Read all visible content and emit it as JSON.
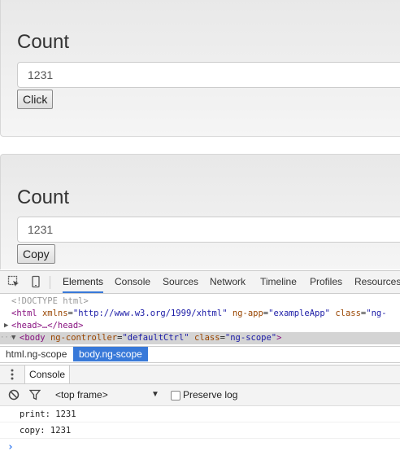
{
  "panels": [
    {
      "title": "Count",
      "input_value": "1231",
      "button_label": "Click"
    },
    {
      "title": "Count",
      "input_value": "1231",
      "button_label": "Copy"
    }
  ],
  "devtools": {
    "tabs": [
      "Elements",
      "Console",
      "Sources",
      "Network",
      "Timeline",
      "Profiles",
      "Resources"
    ],
    "active_tab": "Elements",
    "dom": {
      "doctype": "<!DOCTYPE html>",
      "html_open": "<html",
      "html_attr1_name": "xmlns",
      "html_attr1_value": "\"http://www.w3.org/1999/xhtml\"",
      "html_attr2_name": "ng-app",
      "html_attr2_value": "\"exampleApp\"",
      "html_attr3_name": "class",
      "html_attr3_value": "\"ng-",
      "head": "<head>…</head>",
      "body_open": "<body",
      "body_attr1_name": "ng-controller",
      "body_attr1_value": "\"defaultCtrl\"",
      "body_attr2_name": "class",
      "body_attr2_value": "\"ng-scope\"",
      "body_close": ">",
      "eq": "="
    },
    "breadcrumbs": [
      "html.ng-scope",
      "body.ng-scope"
    ],
    "drawer_tab": "Console",
    "console_toolbar": {
      "frame": "<top frame>",
      "frame_arrow": "▼",
      "preserve_log_label": "Preserve log",
      "preserve_log_checked": false
    },
    "console_output": [
      "print: 1231",
      "copy: 1231"
    ],
    "prompt": "›"
  },
  "colors": {
    "accent": "#3879d9",
    "tag": "#881280",
    "attr_name": "#994500",
    "attr_value": "#1a1aa6"
  }
}
